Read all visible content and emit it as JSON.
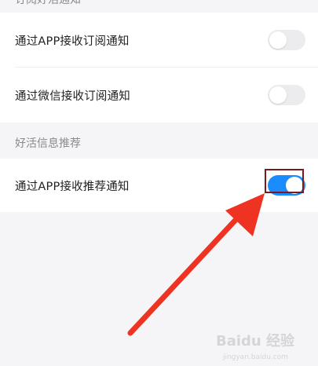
{
  "sections": {
    "top_header": "订阅好活通知",
    "rec_header": "好活信息推荐"
  },
  "rows": {
    "app_subscribe": {
      "label": "通过APP接收订阅通知",
      "enabled": false
    },
    "wechat_subscribe": {
      "label": "通过微信接收订阅通知",
      "enabled": false
    },
    "app_recommend": {
      "label": "通过APP接收推荐通知",
      "enabled": true
    }
  },
  "annotation": {
    "arrow_color": "#ee3322",
    "box_color": "#7a1b1b"
  },
  "watermark": {
    "brand": "Baidu 经验",
    "sub": "jingyan.baidu.com"
  },
  "colors": {
    "toggle_on": "#1a8cff",
    "toggle_off": "#ececee",
    "background": "#f5f5f7"
  }
}
